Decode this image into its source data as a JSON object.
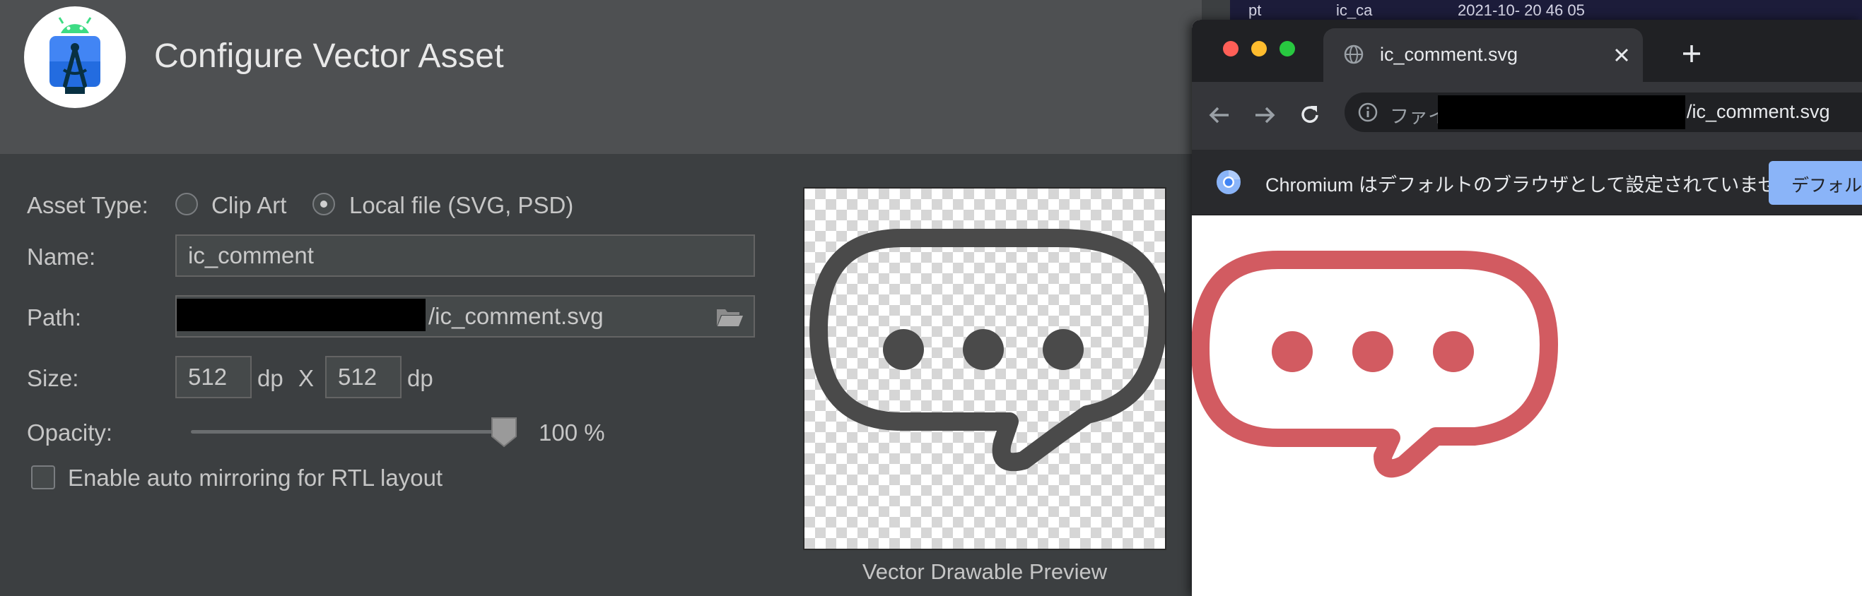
{
  "dialog": {
    "title": "Configure Vector Asset",
    "asset_type_label": "Asset Type:",
    "asset_type_options": [
      {
        "label": "Clip Art",
        "selected": false
      },
      {
        "label": "Local file (SVG, PSD)",
        "selected": true
      }
    ],
    "name_label": "Name:",
    "name_value": "ic_comment",
    "path_label": "Path:",
    "path_value": "/ic_comment.svg",
    "size_label": "Size:",
    "width_value": "512",
    "height_value": "512",
    "dp_unit": "dp",
    "size_separator": "X",
    "opacity_label": "Opacity:",
    "opacity_value": "100 %",
    "opacity_level": 1.0,
    "rtl_label": "Enable auto mirroring for RTL layout",
    "rtl_checked": false,
    "preview_caption": "Vector Drawable Preview",
    "icon_color": "#4a4a4a"
  },
  "browser": {
    "top_strip_fragments": [
      "pt",
      "ic_ca",
      "2021-10-  20 46 05"
    ],
    "tab_title": "ic_comment.svg",
    "address_prefix": "ファイ",
    "address_suffix": "/ic_comment.svg",
    "infobar_text": "Chromium はデフォルトのブラウザとして設定されていません",
    "infobar_button": "デフォルト",
    "icon_color": "#d25b61"
  }
}
